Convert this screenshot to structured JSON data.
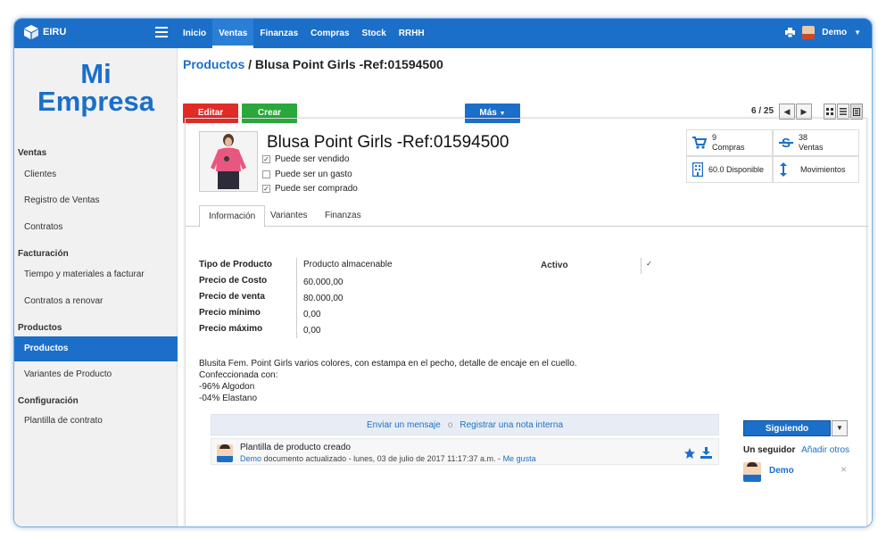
{
  "app": {
    "name": "EIRU"
  },
  "nav": {
    "items": [
      "Inicio",
      "Ventas",
      "Finanzas",
      "Compras",
      "Stock",
      "RRHH"
    ],
    "active": 1
  },
  "user": {
    "name": "Demo"
  },
  "brand": {
    "line1": "Mi",
    "line2": "Empresa"
  },
  "sidebar": {
    "sections": [
      {
        "title": "Ventas",
        "items": [
          "Clientes",
          "Registro de Ventas",
          "Contratos"
        ]
      },
      {
        "title": "Facturación",
        "items": [
          "Tiempo y materiales a facturar",
          "Contratos a renovar"
        ]
      },
      {
        "title": "Productos",
        "items": [
          "Productos",
          "Variantes de Producto"
        ]
      },
      {
        "title": "Configuración",
        "items": [
          "Plantilla de contrato"
        ]
      }
    ],
    "active_item": "Productos"
  },
  "breadcrumb": {
    "parent": "Productos",
    "separator": "/",
    "current": "Blusa Point Girls -Ref:01594500"
  },
  "toolbar": {
    "edit": "Editar",
    "create": "Crear",
    "more": "Más"
  },
  "pager": {
    "text": "6 / 25"
  },
  "product": {
    "name": "Blusa Point Girls -Ref:01594500",
    "options": [
      {
        "label": "Puede ser vendido",
        "checked": true
      },
      {
        "label": "Puede ser un gasto",
        "checked": false
      },
      {
        "label": "Puede ser comprado",
        "checked": true
      }
    ]
  },
  "smart_buttons": {
    "compras_count": "9",
    "compras_label": "Compras",
    "ventas_count": "38",
    "ventas_label": "Ventas",
    "disponible": "60.0 Disponible",
    "movimientos": "Movimientos"
  },
  "tabs": [
    "Información",
    "Variantes",
    "Finanzas"
  ],
  "fields": [
    {
      "label": "Tipo de Producto",
      "value": "Producto almacenable"
    },
    {
      "label": "Precio de Costo",
      "value": "60.000,00"
    },
    {
      "label": "Precio de venta",
      "value": "80.000,00"
    },
    {
      "label": "Precio mínimo",
      "value": "0,00"
    },
    {
      "label": "Precio máximo",
      "value": "0,00"
    }
  ],
  "activo": {
    "label": "Activo",
    "checked": true
  },
  "description": [
    "Blusita Fem. Point Girls varios colores, con estampa en el pecho, detalle de encaje en el cuello.",
    "Confeccionada con:",
    "-96% Algodon",
    "-04% Elastano"
  ],
  "chatter": {
    "send": "Enviar un mensaje",
    "sep": "o",
    "note": "Registrar una nota interna",
    "message_title": "Plantilla de producto creado",
    "author": "Demo",
    "message_meta": "documento actualizado - lunes, 03 de julio de 2017 11:17:37 a.m. -",
    "like": "Me gusta"
  },
  "followers": {
    "button": "Siguiendo",
    "count_label": "Un seguidor",
    "add": "Añadir otros",
    "name": "Demo"
  },
  "colors": {
    "primary": "#1b6fc9",
    "danger": "#e02b27",
    "success": "#2aa83b"
  }
}
